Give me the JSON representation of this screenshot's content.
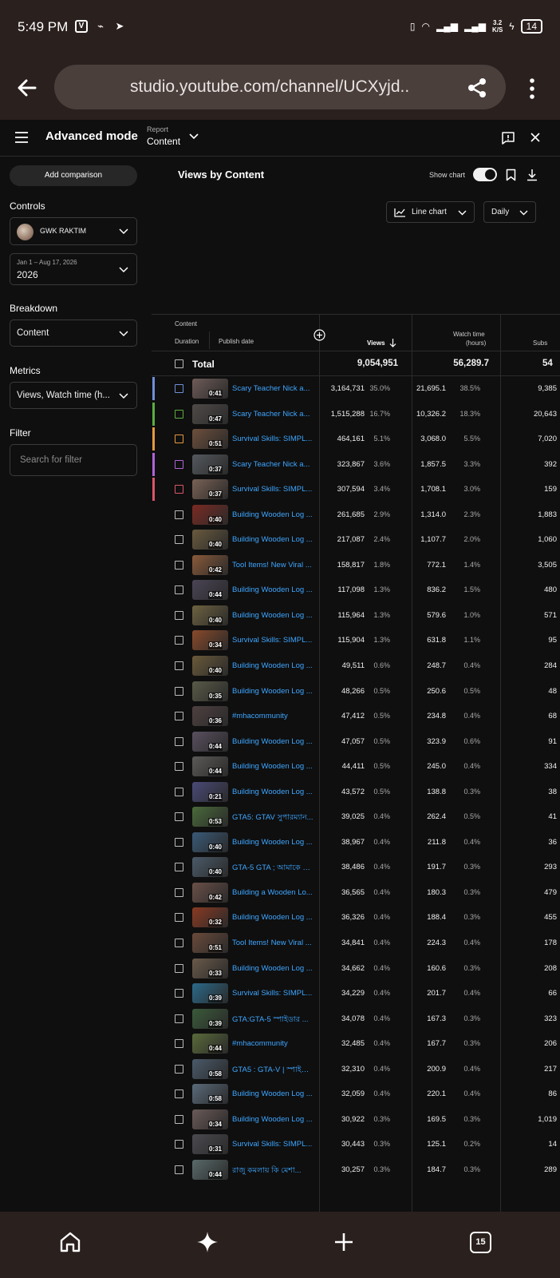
{
  "status_bar": {
    "time": "5:49 PM",
    "network_speed_value": "3.2",
    "network_speed_unit": "K/S",
    "battery": "14"
  },
  "browser": {
    "url": "studio.youtube.com/channel/UCXyjd..",
    "tab_count": "15"
  },
  "header": {
    "title": "Advanced mode",
    "report_label": "Report",
    "report_value": "Content"
  },
  "sidebar": {
    "add_comparison": "Add comparison",
    "controls_label": "Controls",
    "channel_name": "GWK RAKTIM",
    "date_range_small": "Jan 1 – Aug 17, 2026",
    "date_range_value": "2026",
    "breakdown_label": "Breakdown",
    "breakdown_value": "Content",
    "metrics_label": "Metrics",
    "metrics_value": "Views, Watch time (h...",
    "filter_label": "Filter",
    "filter_placeholder": "Search for filter"
  },
  "main": {
    "chart_title": "Views by Content",
    "show_chart_label": "Show chart",
    "show_chart_on": true,
    "chart_type": "Line chart",
    "interval": "Daily"
  },
  "table": {
    "headers": {
      "content": "Content",
      "duration": "Duration",
      "publish_date": "Publish date",
      "views": "Views",
      "watch_time_line1": "Watch time",
      "watch_time_line2": "(hours)",
      "subs": "Subs"
    },
    "total": {
      "label": "Total",
      "views": "9,054,951",
      "watch": "56,289.7",
      "subs": "54"
    },
    "rows": [
      {
        "title": "Scary Teacher Nick a...",
        "dur": "0:41",
        "views": "3,164,731",
        "vp": "35.0%",
        "watch": "21,695.1",
        "wp": "38.5%",
        "subs": "9,385",
        "stripe": "#6f8fd8",
        "thumb": "#6e5b58"
      },
      {
        "title": "Scary Teacher Nick a...",
        "dur": "0:47",
        "views": "1,515,288",
        "vp": "16.7%",
        "watch": "10,326.2",
        "wp": "18.3%",
        "subs": "20,643",
        "stripe": "#5cad3f",
        "thumb": "#4f4a48"
      },
      {
        "title": "Survival Skills: SIMPL...",
        "dur": "0:51",
        "views": "464,161",
        "vp": "5.1%",
        "watch": "3,068.0",
        "wp": "5.5%",
        "subs": "7,020",
        "stripe": "#e49a3b",
        "thumb": "#6d4f3c"
      },
      {
        "title": "Scary Teacher Nick a...",
        "dur": "0:37",
        "views": "323,867",
        "vp": "3.6%",
        "watch": "1,857.5",
        "wp": "3.3%",
        "subs": "392",
        "stripe": "#b064d6",
        "thumb": "#55595e"
      },
      {
        "title": "Survival Skills: SIMPL...",
        "dur": "0:37",
        "views": "307,594",
        "vp": "3.4%",
        "watch": "1,708.1",
        "wp": "3.0%",
        "subs": "159",
        "stripe": "#d9566a",
        "thumb": "#7a6255"
      },
      {
        "title": "Building Wooden Log ...",
        "dur": "0:40",
        "views": "261,685",
        "vp": "2.9%",
        "watch": "1,314.0",
        "wp": "2.3%",
        "subs": "1,883",
        "stripe": "",
        "thumb": "#7a2a22"
      },
      {
        "title": "Building Wooden Log ...",
        "dur": "0:40",
        "views": "217,087",
        "vp": "2.4%",
        "watch": "1,107.7",
        "wp": "2.0%",
        "subs": "1,060",
        "stripe": "",
        "thumb": "#6a5a3e"
      },
      {
        "title": "Tool Items! New Viral ...",
        "dur": "0:42",
        "views": "158,817",
        "vp": "1.8%",
        "watch": "772.1",
        "wp": "1.4%",
        "subs": "3,505",
        "stripe": "",
        "thumb": "#8a5a3a"
      },
      {
        "title": "Building Wooden Log ...",
        "dur": "0:44",
        "views": "117,098",
        "vp": "1.3%",
        "watch": "836.2",
        "wp": "1.5%",
        "subs": "480",
        "stripe": "",
        "thumb": "#4a4455"
      },
      {
        "title": "Building Wooden Log ...",
        "dur": "0:40",
        "views": "115,964",
        "vp": "1.3%",
        "watch": "579.6",
        "wp": "1.0%",
        "subs": "571",
        "stripe": "",
        "thumb": "#6e6240"
      },
      {
        "title": "Survival Skills: SIMPL...",
        "dur": "0:34",
        "views": "115,904",
        "vp": "1.3%",
        "watch": "631.8",
        "wp": "1.1%",
        "subs": "95",
        "stripe": "",
        "thumb": "#8a4a2a"
      },
      {
        "title": "Building Wooden Log ...",
        "dur": "0:40",
        "views": "49,511",
        "vp": "0.6%",
        "watch": "248.7",
        "wp": "0.4%",
        "subs": "284",
        "stripe": "",
        "thumb": "#6a5a3a"
      },
      {
        "title": "Building Wooden Log ...",
        "dur": "0:35",
        "views": "48,266",
        "vp": "0.5%",
        "watch": "250.6",
        "wp": "0.5%",
        "subs": "48",
        "stripe": "",
        "thumb": "#5a5a48"
      },
      {
        "title": "#mhacommunity",
        "dur": "0:36",
        "views": "47,412",
        "vp": "0.5%",
        "watch": "234.8",
        "wp": "0.4%",
        "subs": "68",
        "stripe": "",
        "thumb": "#4e4040"
      },
      {
        "title": "Building Wooden Log ...",
        "dur": "0:44",
        "views": "47,057",
        "vp": "0.5%",
        "watch": "323.9",
        "wp": "0.6%",
        "subs": "91",
        "stripe": "",
        "thumb": "#5a5060"
      },
      {
        "title": "Building Wooden Log ...",
        "dur": "0:44",
        "views": "44,411",
        "vp": "0.5%",
        "watch": "245.0",
        "wp": "0.4%",
        "subs": "334",
        "stripe": "",
        "thumb": "#5c5a58"
      },
      {
        "title": "Building Wooden Log ...",
        "dur": "0:21",
        "views": "43,572",
        "vp": "0.5%",
        "watch": "138.8",
        "wp": "0.3%",
        "subs": "38",
        "stripe": "",
        "thumb": "#4a4a78"
      },
      {
        "title": "GTA5: GTAV সুপারম্যান...",
        "dur": "0:53",
        "views": "39,025",
        "vp": "0.4%",
        "watch": "262.4",
        "wp": "0.5%",
        "subs": "41",
        "stripe": "",
        "thumb": "#4a6a3a"
      },
      {
        "title": "Building Wooden Log ...",
        "dur": "0:40",
        "views": "38,967",
        "vp": "0.4%",
        "watch": "211.8",
        "wp": "0.4%",
        "subs": "36",
        "stripe": "",
        "thumb": "#3a5a78"
      },
      {
        "title": "GTA-5 GTA ; আমাকে সু...",
        "dur": "0:40",
        "views": "38,486",
        "vp": "0.4%",
        "watch": "191.7",
        "wp": "0.3%",
        "subs": "293",
        "stripe": "",
        "thumb": "#4a5a68"
      },
      {
        "title": "Building a Wooden Lo...",
        "dur": "0:42",
        "views": "36,565",
        "vp": "0.4%",
        "watch": "180.3",
        "wp": "0.3%",
        "subs": "479",
        "stripe": "",
        "thumb": "#6a5048"
      },
      {
        "title": "Building Wooden Log ...",
        "dur": "0:32",
        "views": "36,326",
        "vp": "0.4%",
        "watch": "188.4",
        "wp": "0.3%",
        "subs": "455",
        "stripe": "",
        "thumb": "#8a3a22"
      },
      {
        "title": "Tool Items! New Viral ...",
        "dur": "0:51",
        "views": "34,841",
        "vp": "0.4%",
        "watch": "224.3",
        "wp": "0.4%",
        "subs": "178",
        "stripe": "",
        "thumb": "#6a4a3a"
      },
      {
        "title": "Building Wooden Log ...",
        "dur": "0:33",
        "views": "34,662",
        "vp": "0.4%",
        "watch": "160.6",
        "wp": "0.3%",
        "subs": "208",
        "stripe": "",
        "thumb": "#6a5a4a"
      },
      {
        "title": "Survival Skills: SIMPL...",
        "dur": "0:39",
        "views": "34,229",
        "vp": "0.4%",
        "watch": "201.7",
        "wp": "0.4%",
        "subs": "66",
        "stripe": "",
        "thumb": "#2a6a8a"
      },
      {
        "title": "GTA:GTA-5 স্পাইডার ...",
        "dur": "0:39",
        "views": "34,078",
        "vp": "0.4%",
        "watch": "167.3",
        "wp": "0.3%",
        "subs": "323",
        "stripe": "",
        "thumb": "#3a5a3a"
      },
      {
        "title": "#mhacommunity",
        "dur": "0:44",
        "views": "32,485",
        "vp": "0.4%",
        "watch": "167.7",
        "wp": "0.3%",
        "subs": "206",
        "stripe": "",
        "thumb": "#5a6a3a"
      },
      {
        "title": "GTA5 : GTA-V | স্পাইডা...",
        "dur": "0:58",
        "views": "32,310",
        "vp": "0.4%",
        "watch": "200.9",
        "wp": "0.4%",
        "subs": "217",
        "stripe": "",
        "thumb": "#4a5a6a"
      },
      {
        "title": "Building Wooden Log ...",
        "dur": "0:58",
        "views": "32,059",
        "vp": "0.4%",
        "watch": "220.1",
        "wp": "0.4%",
        "subs": "86",
        "stripe": "",
        "thumb": "#5a6a7a"
      },
      {
        "title": "Building Wooden Log ...",
        "dur": "0:34",
        "views": "30,922",
        "vp": "0.3%",
        "watch": "169.5",
        "wp": "0.3%",
        "subs": "1,019",
        "stripe": "",
        "thumb": "#6a5a58"
      },
      {
        "title": "Survival Skills: SIMPL...",
        "dur": "0:31",
        "views": "30,443",
        "vp": "0.3%",
        "watch": "125.1",
        "wp": "0.2%",
        "subs": "14",
        "stripe": "",
        "thumb": "#4a4a50"
      },
      {
        "title": "রাজু কমলায় কি মেশা...",
        "dur": "0:44",
        "views": "30,257",
        "vp": "0.3%",
        "watch": "184.7",
        "wp": "0.3%",
        "subs": "289",
        "stripe": "",
        "thumb": "#5a6a6a"
      }
    ]
  }
}
